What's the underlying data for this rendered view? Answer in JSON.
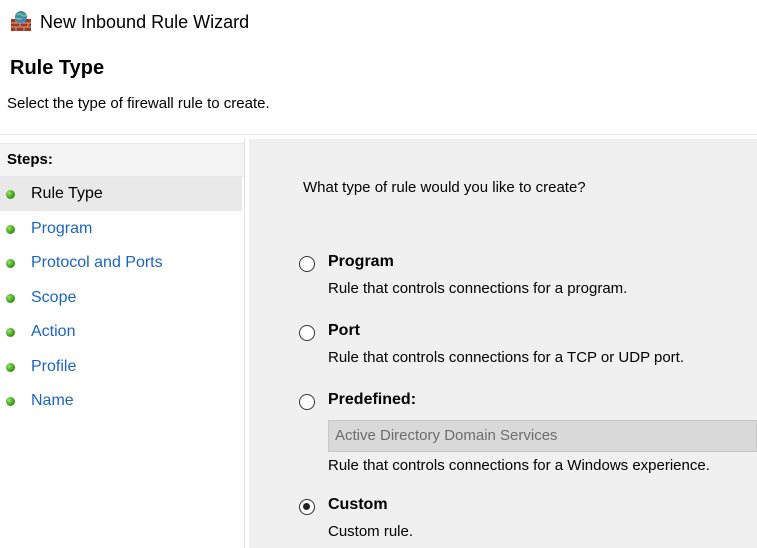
{
  "window": {
    "title": "New Inbound Rule Wizard",
    "icon": "firewall-icon"
  },
  "header": {
    "title": "Rule Type",
    "subtitle": "Select the type of firewall rule to create."
  },
  "steps": {
    "header": "Steps:",
    "items": [
      {
        "label": "Rule Type",
        "current": true
      },
      {
        "label": "Program",
        "current": false
      },
      {
        "label": "Protocol and Ports",
        "current": false
      },
      {
        "label": "Scope",
        "current": false
      },
      {
        "label": "Action",
        "current": false
      },
      {
        "label": "Profile",
        "current": false
      },
      {
        "label": "Name",
        "current": false
      }
    ]
  },
  "main": {
    "question": "What type of rule would you like to create?",
    "options": [
      {
        "label": "Program",
        "description": "Rule that controls connections for a program.",
        "selected": false
      },
      {
        "label": "Port",
        "description": "Rule that controls connections for a TCP or UDP port.",
        "selected": false
      },
      {
        "label": "Predefined:",
        "description": "Rule that controls connections for a Windows experience.",
        "selected": false,
        "select_value": "Active Directory Domain Services",
        "select_enabled": false
      },
      {
        "label": "Custom",
        "description": "Custom rule.",
        "selected": true
      }
    ]
  },
  "colors": {
    "link": "#1a64c8",
    "content_bg": "#f0f0f0",
    "step_dot": "#3fa21a"
  }
}
